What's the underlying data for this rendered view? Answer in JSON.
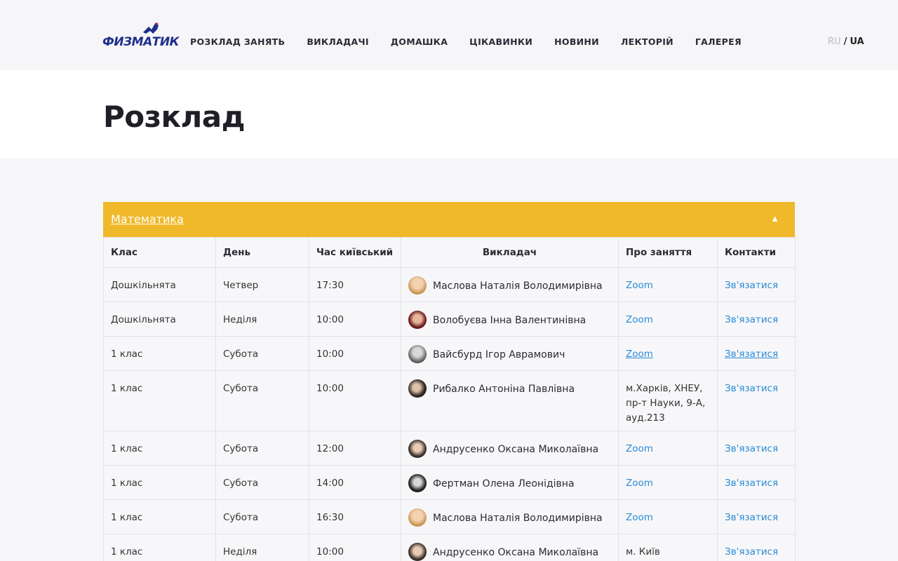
{
  "logo": {
    "text": "ФИЗМАТИК"
  },
  "nav": [
    "РОЗКЛАД ЗАНЯТЬ",
    "ВИКЛАДАЧІ",
    "ДОМАШКА",
    "ЦІКАВИНКИ",
    "НОВИНИ",
    "ЛЕКТОРІЙ",
    "ГАЛЕРЕЯ"
  ],
  "lang": {
    "ru": "RU",
    "sep": "/",
    "ua": "UA"
  },
  "page": {
    "title": "Розклад"
  },
  "section": {
    "title": "Математика",
    "arrow": "▲"
  },
  "table": {
    "headers": [
      "Клас",
      "День",
      "Час київський",
      "Викладач",
      "Про заняття",
      "Контакти"
    ],
    "rows": [
      {
        "grade": "Дошкільнята",
        "day": "Четвер",
        "time": "17:30",
        "teacher": "Маслова Наталія Володимирівна",
        "about": "Zoom",
        "contact": "Зв'язатися"
      },
      {
        "grade": "Дошкільнята",
        "day": "Неділя",
        "time": "10:00",
        "teacher": "Волобуєва Інна Валентинівна",
        "about": "Zoom",
        "contact": "Зв'язатися"
      },
      {
        "grade": "1 клас",
        "day": "Субота",
        "time": "10:00",
        "teacher": "Вайсбурд Ігор Аврамович",
        "about": "Zoom",
        "contact": "Зв'язатися"
      },
      {
        "grade": "1 клас",
        "day": "Субота",
        "time": "10:00",
        "teacher": "Рибалко Антоніна Павлівна",
        "about": "м.Харків, ХНЕУ, пр-т Науки, 9-А, ауд.213",
        "contact": "Зв'язатися"
      },
      {
        "grade": "1 клас",
        "day": "Субота",
        "time": "12:00",
        "teacher": "Андрусенко Оксана Миколаївна",
        "about": "Zoom",
        "contact": "Зв'язатися"
      },
      {
        "grade": "1 клас",
        "day": "Субота",
        "time": "14:00",
        "teacher": "Фертман Олена Леонідівна",
        "about": "Zoom",
        "contact": "Зв'язатися"
      },
      {
        "grade": "1 клас",
        "day": "Субота",
        "time": "16:30",
        "teacher": "Маслова Наталія Володимирівна",
        "about": "Zoom",
        "contact": "Зв'язатися"
      },
      {
        "grade": "1 клас",
        "day": "Неділя",
        "time": "10:00",
        "teacher": "Андрусенко Оксана Миколаївна",
        "about": "м. Київ",
        "contact": "Зв'язатися"
      }
    ]
  },
  "colors": {
    "accent": "#f0b92a",
    "link": "#2a8bd6",
    "logo_blue": "#1e2f8a"
  }
}
